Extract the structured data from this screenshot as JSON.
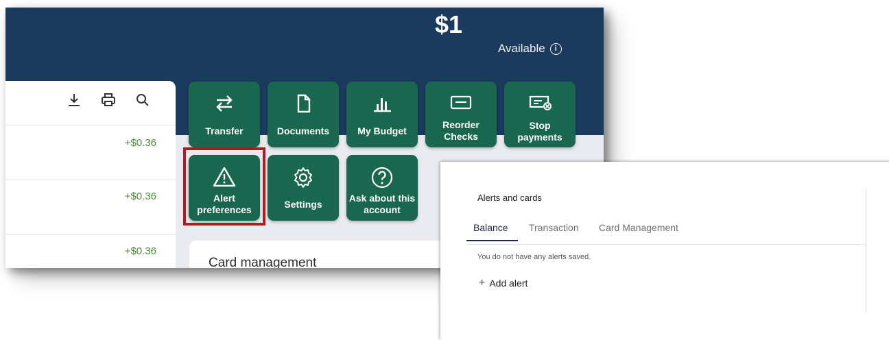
{
  "header": {
    "balance": "$1",
    "available_label": "Available",
    "info_icon": "info-icon"
  },
  "transactions": {
    "tools": [
      "download-icon",
      "print-icon",
      "search-icon"
    ],
    "amounts": [
      "+$0.36",
      "+$0.36",
      "+$0.36"
    ]
  },
  "actions": {
    "transfer": "Transfer",
    "documents": "Documents",
    "my_budget": "My Budget",
    "reorder_checks_1": "Reorder",
    "reorder_checks_2": "Checks",
    "stop_payments_1": "Stop",
    "stop_payments_2": "payments",
    "alert_prefs_1": "Alert",
    "alert_prefs_2": "preferences",
    "settings": "Settings",
    "ask_1": "Ask about this",
    "ask_2": "account"
  },
  "card_management": {
    "title": "Card management"
  },
  "alerts": {
    "title": "Alerts and cards",
    "tabs": [
      "Balance",
      "Transaction",
      "Card Management"
    ],
    "active_tab": "Balance",
    "empty_message": "You do not have any alerts saved.",
    "add_alert": "Add alert"
  },
  "colors": {
    "banner": "#1b3a5e",
    "tile": "#18674e",
    "highlight": "#b3191d",
    "positive_amount": "#4e8a3a"
  }
}
